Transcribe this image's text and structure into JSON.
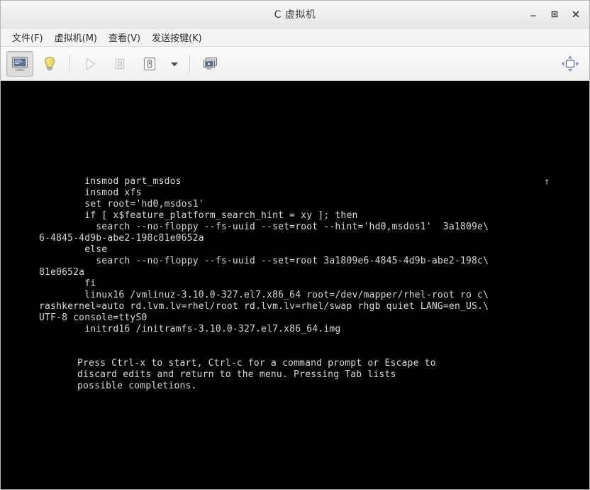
{
  "window": {
    "title": "C 虚拟机",
    "controls": [
      {
        "name": "minimize",
        "glyph": "_"
      },
      {
        "name": "maximize",
        "glyph": "□"
      },
      {
        "name": "close",
        "glyph": "✕"
      }
    ]
  },
  "menubar": {
    "items": [
      {
        "label": "文件(F)",
        "name": "menu-file"
      },
      {
        "label": "虚拟机(M)",
        "name": "menu-virtual-machine"
      },
      {
        "label": "查看(V)",
        "name": "menu-view"
      },
      {
        "label": "发送按键(K)",
        "name": "menu-send-key"
      }
    ]
  },
  "toolbar": {
    "buttons": [
      {
        "name": "console-view-button",
        "icon": "monitor-icon",
        "state": "pressed"
      },
      {
        "name": "show-details-button",
        "icon": "lightbulb-icon",
        "state": "normal"
      },
      {
        "name": "run-button",
        "icon": "play-icon",
        "state": "disabled"
      },
      {
        "name": "pause-button",
        "icon": "pause-icon",
        "state": "disabled"
      },
      {
        "name": "shutdown-button",
        "icon": "power-icon",
        "state": "normal"
      },
      {
        "name": "shutdown-menu-button",
        "icon": "chevron-down-icon",
        "state": "normal"
      },
      {
        "name": "snapshots-button",
        "icon": "screens-icon",
        "state": "normal"
      }
    ],
    "right_button": {
      "name": "fullscreen-button",
      "icon": "resize-to-vm-icon"
    }
  },
  "console": {
    "scroll_indicator": "↑",
    "grub_text": "        insmod part_msdos\n        insmod xfs\n        set root='hd0,msdos1'\n        if [ x$feature_platform_search_hint = xy ]; then\n          search --no-floppy --fs-uuid --set=root --hint='hd0,msdos1'  3a1809e\\\n6-4845-4d9b-abe2-198c81e0652a\n        else\n          search --no-floppy --fs-uuid --set=root 3a1809e6-4845-4d9b-abe2-198c\\\n81e0652a\n        fi\n        linux16 /vmlinuz-3.10.0-327.el7.x86_64 root=/dev/mapper/rhel-root ro c\\\nrashkernel=auto rd.lvm.lv=rhel/root rd.lvm.lv=rhel/swap rhgb quiet LANG=en_US.\\\nUTF-8 console=ttyS0\n        initrd16 /initramfs-3.10.0-327.el7.x86_64.img",
    "help_text": "Press Ctrl-x to start, Ctrl-c for a command prompt or Escape to\ndiscard edits and return to the menu. Pressing Tab lists\npossible completions."
  },
  "colors": {
    "console_bg": "#000000",
    "console_fg": "#d9d9d9",
    "chrome_bg": "#f2f1f0",
    "titlebar_bg": "#eeedec"
  }
}
